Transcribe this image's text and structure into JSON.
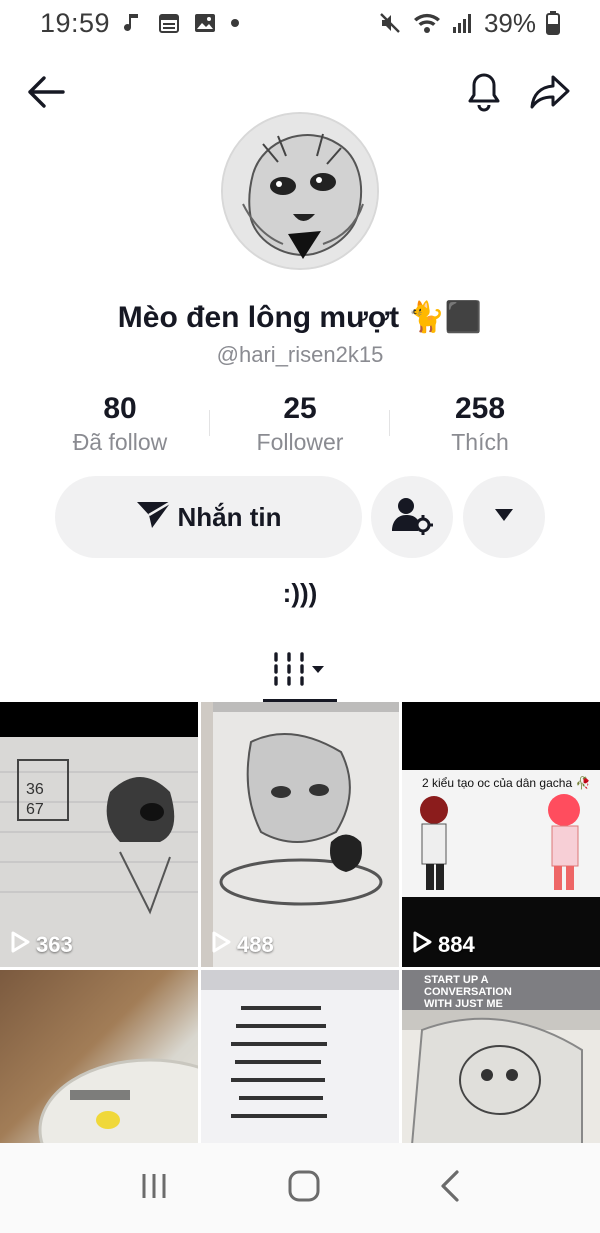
{
  "status_bar": {
    "time": "19:59",
    "battery": "39%"
  },
  "profile": {
    "display_name": "Mèo đen lông mượt 🐈⬛",
    "username": "@hari_risen2k15",
    "bio": ":)))"
  },
  "stats": [
    {
      "value": "80",
      "label": "Đã follow"
    },
    {
      "value": "25",
      "label": "Follower"
    },
    {
      "value": "258",
      "label": "Thích"
    }
  ],
  "actions": {
    "message_label": "Nhắn tin"
  },
  "videos": [
    {
      "views": "363"
    },
    {
      "views": "488"
    },
    {
      "views": "884",
      "caption": "2 kiểu tạo oc của dân gacha 🥀"
    },
    {
      "views": ""
    },
    {
      "views": ""
    },
    {
      "views": "",
      "caption": "START UP A CONVERSATION WITH JUST ME"
    }
  ],
  "icons": {
    "back": "arrow-left-icon",
    "bell": "bell-icon",
    "share": "share-icon",
    "send": "paper-plane-icon",
    "friend_settings": "user-settings-icon",
    "more": "chevron-down-icon",
    "videos_tab": "grid-videos-icon"
  }
}
